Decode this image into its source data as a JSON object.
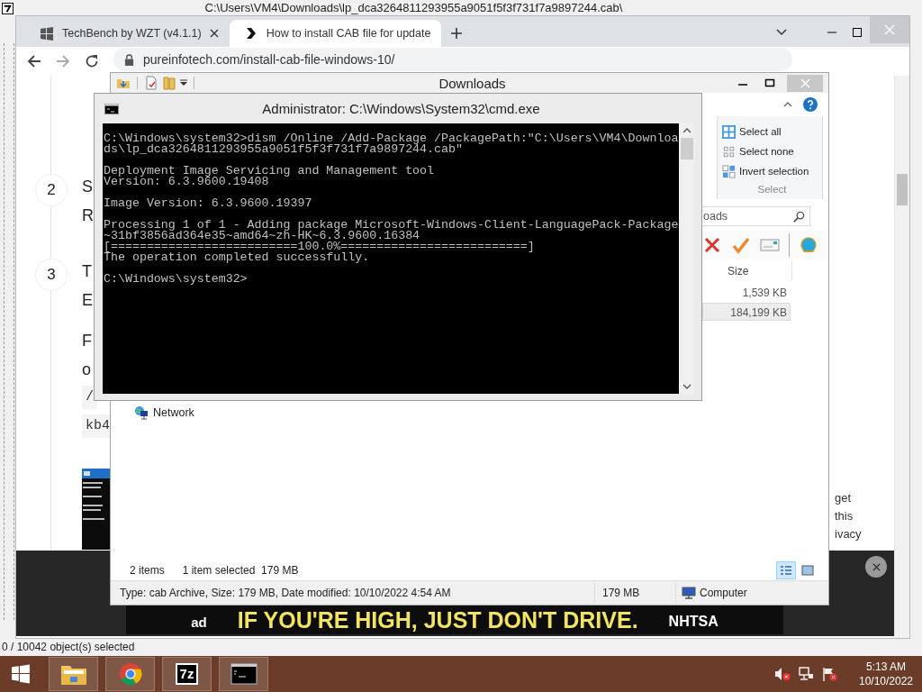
{
  "background_window": {
    "title": "C:\\Users\\VM4\\Downloads\\lp_dca3264811293955a9051f5f3f731f7a9897244.cab\\",
    "status": "0 / 10042 object(s) selected"
  },
  "browser": {
    "tabs": [
      {
        "kind": "windows",
        "label": "TechBench by WZT (v4.1.1)",
        "selected": false
      },
      {
        "kind": "chevron",
        "label": "How to install CAB file for update",
        "selected": true
      }
    ],
    "address": "pureinfotech.com/install-cab-file-windows-10/",
    "steps": [
      {
        "number": "2",
        "lines": [
          "S",
          "R"
        ]
      },
      {
        "number": "3",
        "lines": [
          "T",
          "E"
        ]
      }
    ],
    "paragraph": [
      "F",
      "o"
    ],
    "code": [
      "/",
      "kb4"
    ],
    "screenshot": {
      "kind": "picture"
    },
    "aside": [
      "get",
      "this",
      "ivacy"
    ],
    "ad": {
      "logo": "ad",
      "headline": "IF YOU'RE HIGH, JUST DON'T DRIVE.",
      "sponsor": "NHTSA"
    }
  },
  "explorer": {
    "title": "Downloads",
    "ribbon": {
      "commands": [
        {
          "kind": "all",
          "label": "Select all"
        },
        {
          "kind": "none",
          "label": "Select none"
        },
        {
          "kind": "invert",
          "label": "Invert selection"
        }
      ],
      "group": "Select"
    },
    "search": {
      "placeholder": "oads"
    },
    "size_header": "Size",
    "rows": [
      {
        "size": "1,539 KB",
        "selected": false
      },
      {
        "size": "184,199 KB",
        "selected": true
      }
    ],
    "nav": [
      "Network"
    ],
    "item_count": "2 items",
    "selection": "1 item selected  179 MB",
    "views": [
      {
        "kind": "details",
        "selected": true
      },
      {
        "kind": "thumbnails",
        "selected": false
      }
    ],
    "details": {
      "info": "Type: cab Archive, Size: 179 MB, Date modified: 10/10/2022 4:54 AM",
      "size": "179 MB",
      "location": "Computer"
    }
  },
  "console": {
    "title": "Administrator: C:\\Windows\\System32\\cmd.exe",
    "blocks": [
      [
        "C:\\Windows\\system32>dism /Online /Add-Package /PackagePath:\"C:\\Users\\VM4\\Downloa",
        "ds\\lp_dca3264811293955a9051f5f3f731f7a9897244.cab\""
      ],
      [
        "Deployment Image Servicing and Management tool",
        "Version: 6.3.9600.19408"
      ],
      [
        "Image Version: 6.3.9600.19397"
      ],
      [
        "Processing 1 of 1 - Adding package Microsoft-Windows-Client-LanguagePack-Package",
        "~31bf3856ad364e35~amd64~zh-HK~6.3.9600.16384",
        "[==========================100.0%==========================]",
        "The operation completed successfully."
      ],
      [
        "C:\\Windows\\system32>"
      ]
    ]
  },
  "taskbar": {
    "apps": [
      {
        "kind": "explorer"
      },
      {
        "kind": "chrome"
      },
      {
        "kind": "archiver",
        "label": "7z"
      },
      {
        "kind": "console"
      }
    ],
    "time": "5:13 AM",
    "date": "10/10/2022"
  }
}
